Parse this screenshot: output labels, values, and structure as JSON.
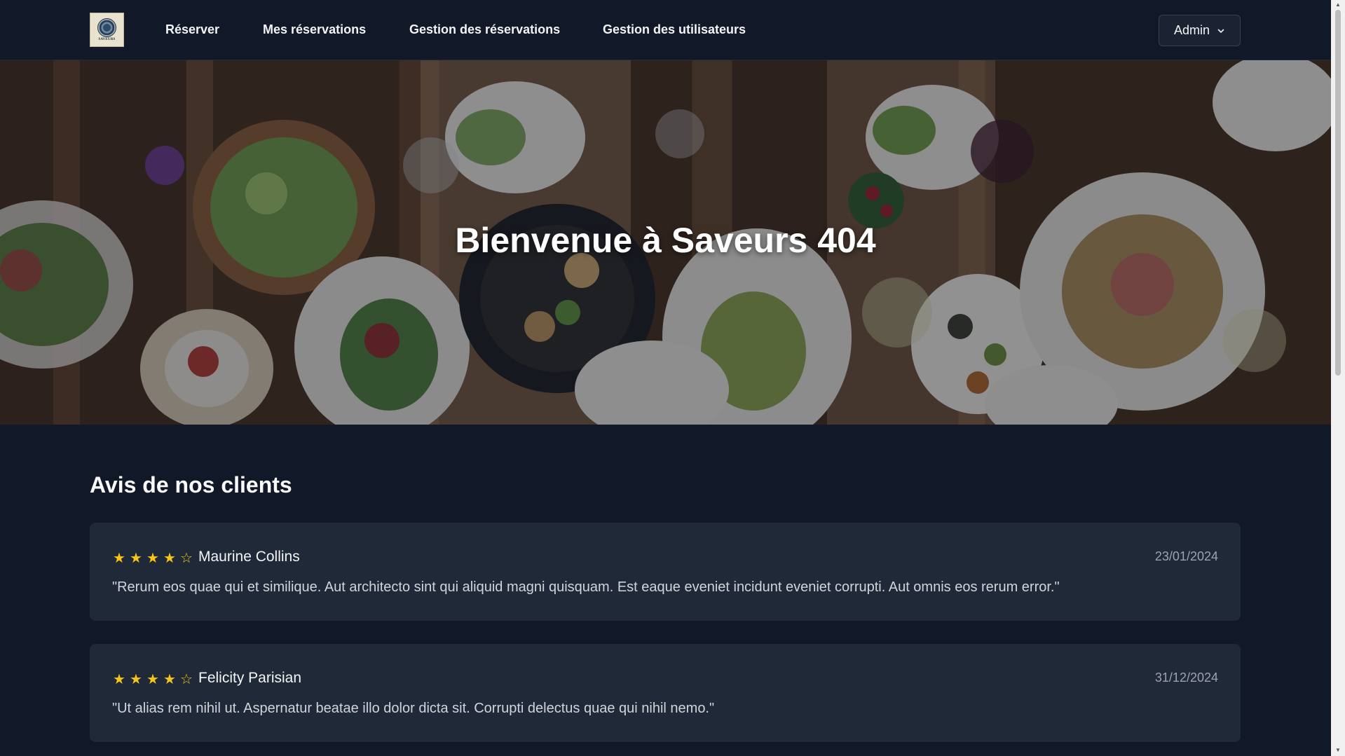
{
  "navbar": {
    "logo": {
      "icon": "restaurant-logo-icon",
      "text": "SAVEURS"
    },
    "links": [
      "Réserver",
      "Mes réservations",
      "Gestion des réservations",
      "Gestion des utilisateurs"
    ],
    "admin": {
      "label": "Admin",
      "icon": "chevron-down-icon"
    }
  },
  "hero": {
    "title": "Bienvenue à Saveurs 404",
    "image": "restaurant-table-food-image"
  },
  "reviews": {
    "title": "Avis de nos clients",
    "items": [
      {
        "stars": [
          "★",
          "★",
          "★",
          "★",
          "☆"
        ],
        "rating": 4,
        "author": "Maurine Collins",
        "date": "23/01/2024",
        "text": "\"Rerum eos quae qui et similique. Aut architecto sint qui aliquid magni quisquam. Est eaque eveniet incidunt eveniet corrupti. Aut omnis eos rerum error.\""
      },
      {
        "stars": [
          "★",
          "★",
          "★",
          "★",
          "☆"
        ],
        "rating": 4,
        "author": "Felicity Parisian",
        "date": "31/12/2024",
        "text": "\"Ut alias rem nihil ut. Aspernatur beatae illo dolor dicta sit. Corrupti delectus quae qui nihil nemo.\""
      }
    ]
  },
  "colors": {
    "background": "#111827",
    "card": "#1f2937",
    "star": "#f5c518",
    "text": "#f3f4f6",
    "muted": "#9ca3af"
  }
}
